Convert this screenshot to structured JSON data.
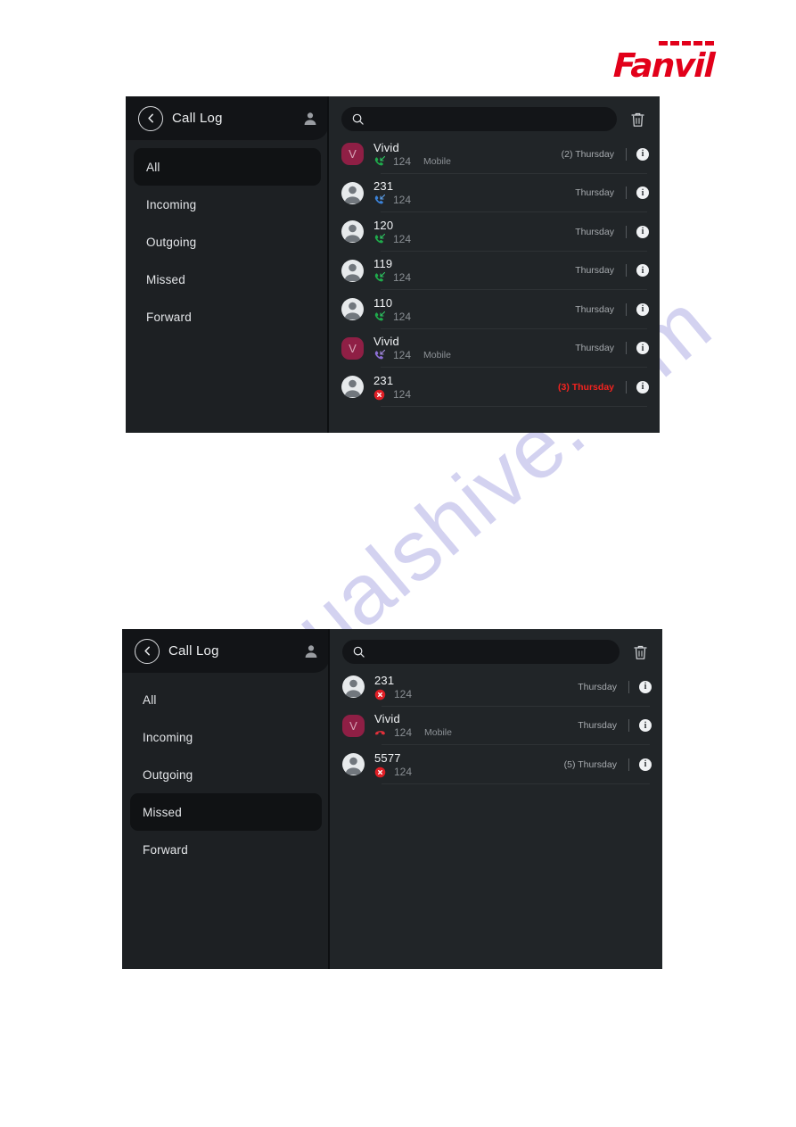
{
  "page": {
    "watermark": "manualshive.com",
    "brand": {
      "name": "Fanvil",
      "color": "#e2001a"
    }
  },
  "colors": {
    "accent_red": "#e2001a",
    "missed_red": "#f2231f",
    "incoming_green": "#1faa4b",
    "outgoing_blue": "#3b82d8",
    "forward_purple": "#8c6fd6",
    "avatar_letter_bg": "#8f1f45",
    "panel_bg": "#212528",
    "sidebar_bg": "#1d2023",
    "topbar_bg": "#121417",
    "selected_bg": "#101214"
  },
  "screenshots": [
    {
      "id": "call-log-all",
      "topbar": {
        "back_icon": "chevron-left-icon",
        "title": "Call Log",
        "account_icon": "person-icon"
      },
      "sidebar": {
        "items": [
          {
            "label": "All",
            "selected": true
          },
          {
            "label": "Incoming",
            "selected": false
          },
          {
            "label": "Outgoing",
            "selected": false
          },
          {
            "label": "Missed",
            "selected": false
          },
          {
            "label": "Forward",
            "selected": false
          }
        ]
      },
      "search": {
        "icon": "search-icon",
        "value": "",
        "placeholder": ""
      },
      "delete_icon": "trash-icon",
      "calls": [
        {
          "name": "Vivid",
          "avatar_type": "letter",
          "avatar_letter": "V",
          "direction": "incoming",
          "direction_icon": "phone-incoming-icon",
          "extension": "124",
          "tag": "Mobile",
          "time": "(2) Thursday",
          "missed": false,
          "info_icon": "info-icon"
        },
        {
          "name": "231",
          "avatar_type": "generic",
          "avatar_letter": "",
          "direction": "outgoing",
          "direction_icon": "phone-outgoing-icon",
          "extension": "124",
          "tag": "",
          "time": "Thursday",
          "missed": false,
          "info_icon": "info-icon"
        },
        {
          "name": "120",
          "avatar_type": "generic",
          "avatar_letter": "",
          "direction": "incoming",
          "direction_icon": "phone-incoming-icon",
          "extension": "124",
          "tag": "",
          "time": "Thursday",
          "missed": false,
          "info_icon": "info-icon"
        },
        {
          "name": "119",
          "avatar_type": "generic",
          "avatar_letter": "",
          "direction": "incoming",
          "direction_icon": "phone-incoming-icon",
          "extension": "124",
          "tag": "",
          "time": "Thursday",
          "missed": false,
          "info_icon": "info-icon"
        },
        {
          "name": "110",
          "avatar_type": "generic",
          "avatar_letter": "",
          "direction": "incoming",
          "direction_icon": "phone-incoming-icon",
          "extension": "124",
          "tag": "",
          "time": "Thursday",
          "missed": false,
          "info_icon": "info-icon"
        },
        {
          "name": "Vivid",
          "avatar_type": "letter",
          "avatar_letter": "V",
          "direction": "forward",
          "direction_icon": "phone-forward-icon",
          "extension": "124",
          "tag": "Mobile",
          "time": "Thursday",
          "missed": false,
          "info_icon": "info-icon"
        },
        {
          "name": "231",
          "avatar_type": "generic",
          "avatar_letter": "",
          "direction": "missed",
          "direction_icon": "phone-missed-icon",
          "extension": "124",
          "tag": "",
          "time": "(3) Thursday",
          "missed": true,
          "info_icon": "info-icon"
        }
      ]
    },
    {
      "id": "call-log-missed",
      "topbar": {
        "back_icon": "chevron-left-icon",
        "title": "Call Log",
        "account_icon": "person-icon"
      },
      "sidebar": {
        "items": [
          {
            "label": "All",
            "selected": false
          },
          {
            "label": "Incoming",
            "selected": false
          },
          {
            "label": "Outgoing",
            "selected": false
          },
          {
            "label": "Missed",
            "selected": true
          },
          {
            "label": "Forward",
            "selected": false
          }
        ]
      },
      "search": {
        "icon": "search-icon",
        "value": "",
        "placeholder": ""
      },
      "delete_icon": "trash-icon",
      "calls": [
        {
          "name": "231",
          "avatar_type": "generic",
          "avatar_letter": "",
          "direction": "missed",
          "direction_icon": "phone-missed-icon",
          "extension": "124",
          "tag": "",
          "time": "Thursday",
          "missed": false,
          "info_icon": "info-icon"
        },
        {
          "name": "Vivid",
          "avatar_type": "letter",
          "avatar_letter": "V",
          "direction": "declined",
          "direction_icon": "phone-declined-icon",
          "extension": "124",
          "tag": "Mobile",
          "time": "Thursday",
          "missed": false,
          "info_icon": "info-icon"
        },
        {
          "name": "5577",
          "avatar_type": "generic",
          "avatar_letter": "",
          "direction": "missed",
          "direction_icon": "phone-missed-icon",
          "extension": "124",
          "tag": "",
          "time": "(5) Thursday",
          "missed": false,
          "info_icon": "info-icon"
        }
      ]
    }
  ]
}
